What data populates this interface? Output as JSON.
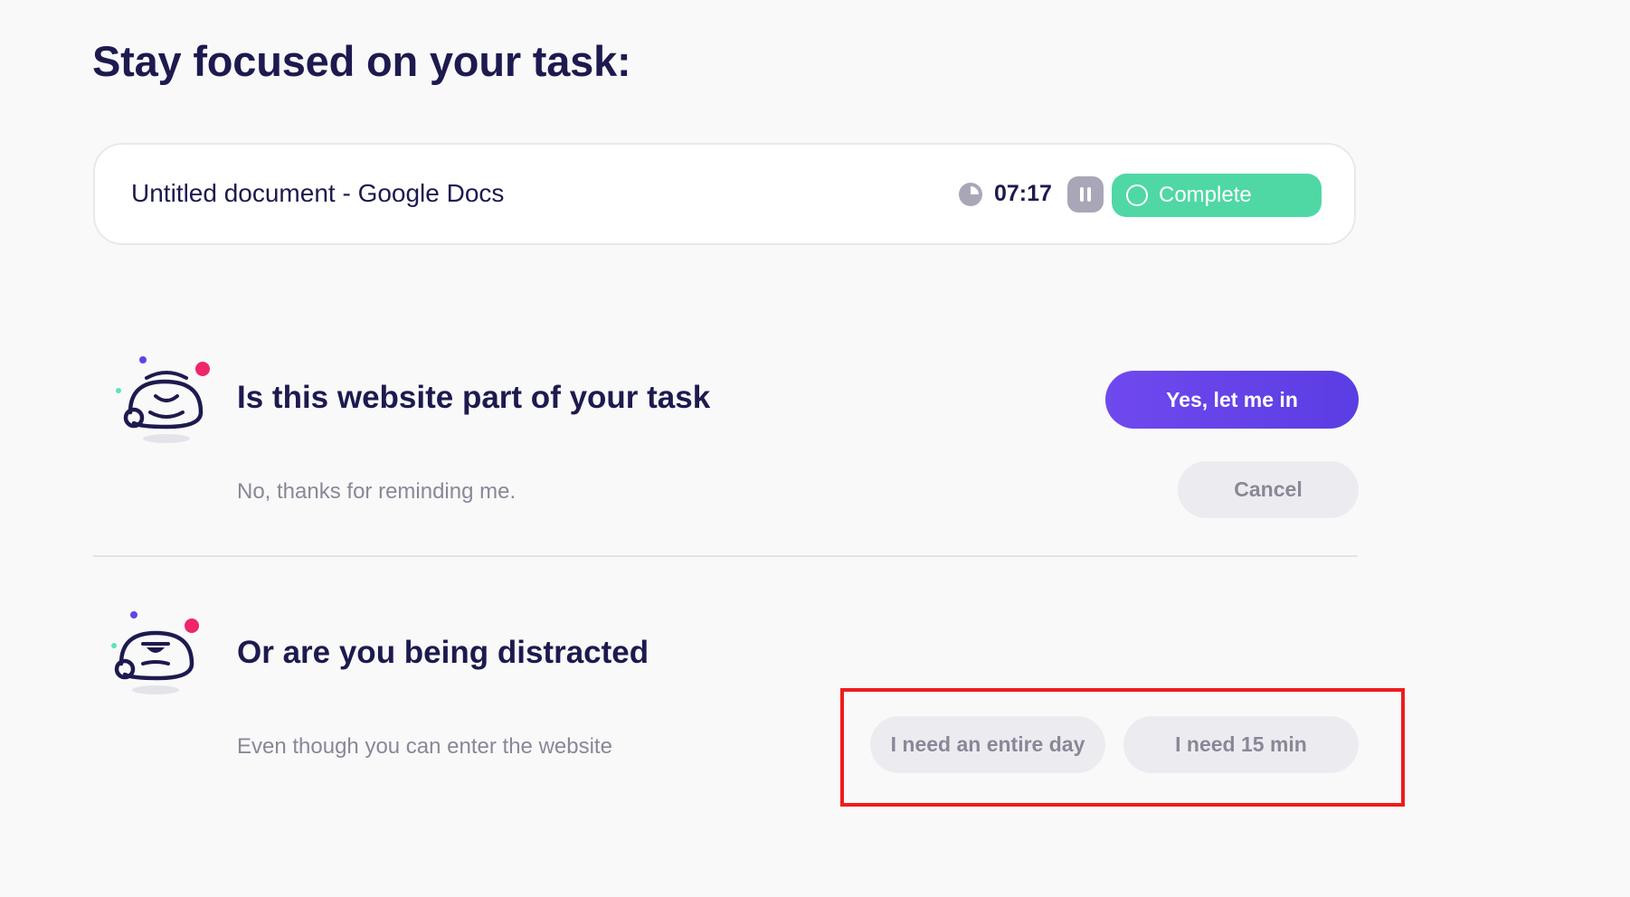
{
  "header": {
    "title": "Stay focused on your task:"
  },
  "task": {
    "name": "Untitled document - Google Docs",
    "timer": "07:17",
    "complete_label": "Complete",
    "icons": {
      "timer": "clock-icon",
      "pause": "pause-icon",
      "complete": "circle-icon"
    }
  },
  "part_of_task": {
    "question": "Is this website part of your task",
    "subtext": "No, thanks for reminding me.",
    "yes_label": "Yes, let me in",
    "cancel_label": "Cancel",
    "mascot": "happy-mascot-icon"
  },
  "distracted": {
    "question": "Or are you being distracted",
    "subtext": "Even though you can enter the website",
    "entire_day_label": "I need an entire day",
    "fifteen_min_label": "I need 15 min",
    "mascot": "annoyed-mascot-icon"
  },
  "colors": {
    "primary": "#6044E8",
    "complete_green": "#4FD8A4",
    "text_dark": "#1D1A4F",
    "text_muted": "#8A8797",
    "highlight_red": "#EE1C1C",
    "accent_pink": "#F0266B",
    "accent_mint": "#5FE3B6"
  }
}
